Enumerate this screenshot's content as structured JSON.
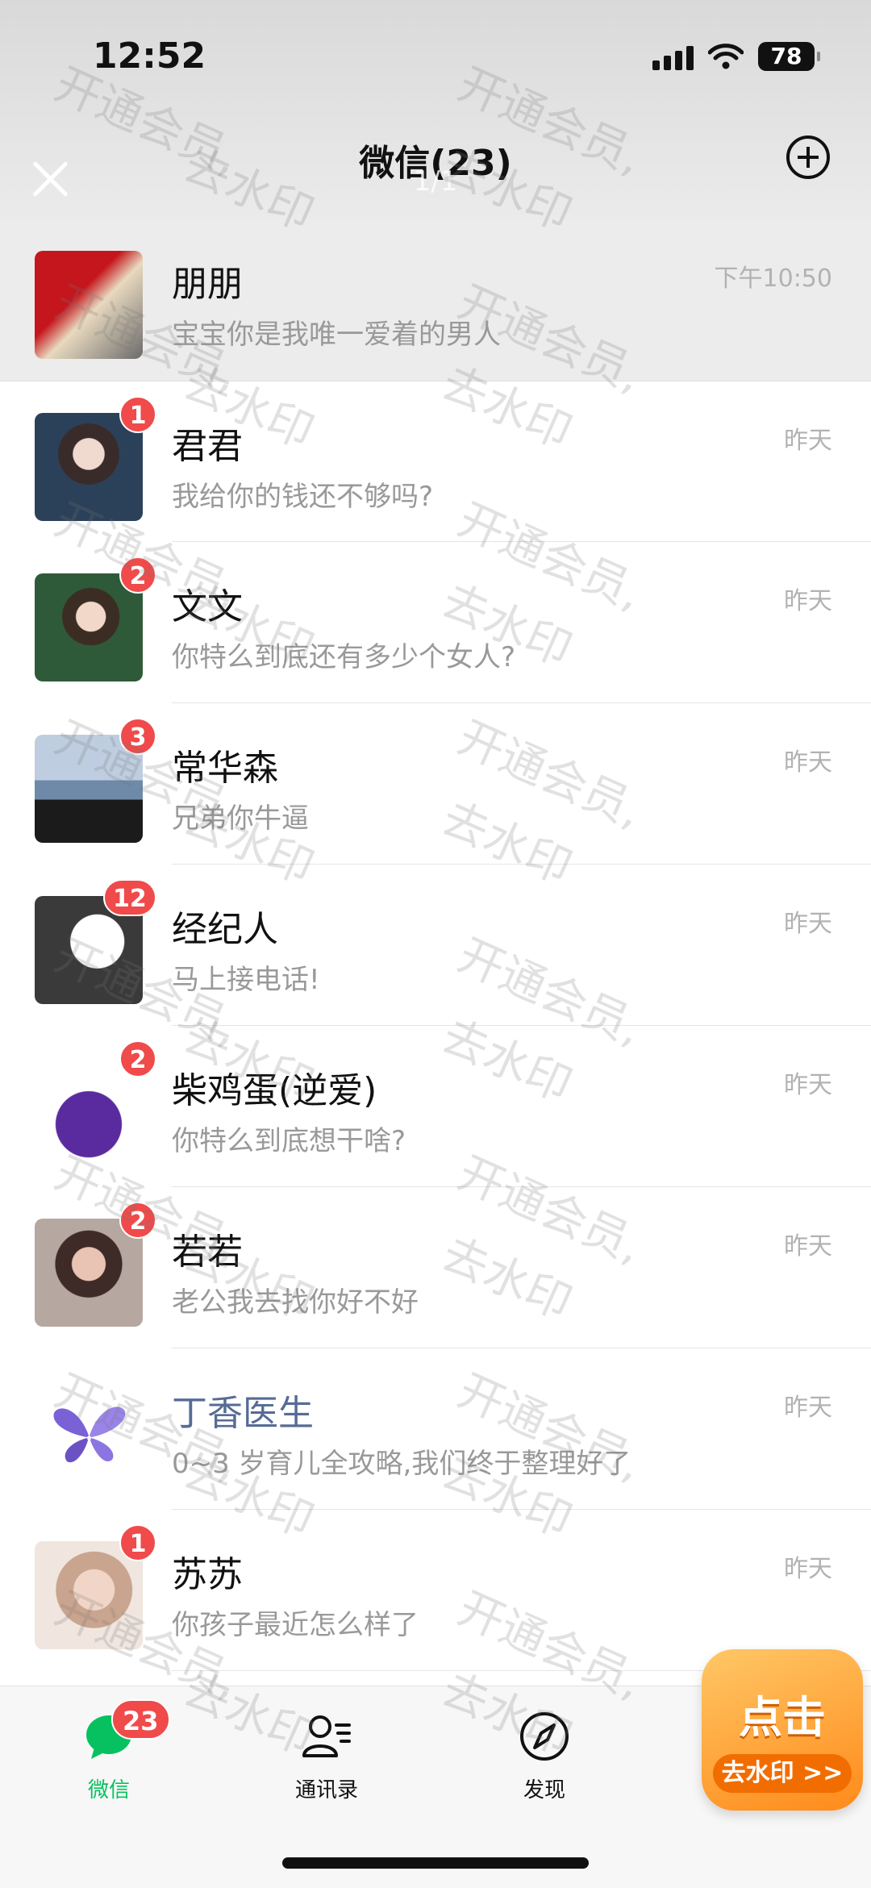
{
  "status_bar": {
    "time": "12:52",
    "battery": "78"
  },
  "nav": {
    "title": "微信(23)",
    "page_indicator": "1/1"
  },
  "chats": [
    {
      "name": "朋朋",
      "preview": "宝宝你是我唯一爱着的男人",
      "time": "下午10:50",
      "badge": "",
      "pinned": true
    },
    {
      "name": "君君",
      "preview": "我给你的钱还不够吗?",
      "time": "昨天",
      "badge": "1"
    },
    {
      "name": "文文",
      "preview": "你特么到底还有多少个女人?",
      "time": "昨天",
      "badge": "2"
    },
    {
      "name": "常华森",
      "preview": "兄弟你牛逼",
      "time": "昨天",
      "badge": "3"
    },
    {
      "name": "经纪人",
      "preview": "马上接电话!",
      "time": "昨天",
      "badge": "12"
    },
    {
      "name": "柴鸡蛋(逆爱)",
      "preview": "你特么到底想干啥?",
      "time": "昨天",
      "badge": "2"
    },
    {
      "name": "若若",
      "preview": "老公我去找你好不好",
      "time": "昨天",
      "badge": "2"
    },
    {
      "name": "丁香医生",
      "preview": "0~3 岁育儿全攻略,我们终于整理好了",
      "time": "昨天",
      "badge": ""
    },
    {
      "name": "苏苏",
      "preview": "你孩子最近怎么样了",
      "time": "昨天",
      "badge": "1"
    }
  ],
  "tabbar": {
    "tabs": [
      {
        "label": "微信",
        "icon": "chat-bubble-icon",
        "badge": "23",
        "active": true
      },
      {
        "label": "通讯录",
        "icon": "contacts-icon"
      },
      {
        "label": "发现",
        "icon": "compass-icon"
      }
    ]
  },
  "promo": {
    "main": "点击",
    "sub": "去水印 >>"
  },
  "watermark": {
    "text_1": "开通会员,",
    "text_2": "去水印"
  },
  "colors": {
    "accent": "#07c160",
    "badge": "#f04a4a",
    "official_name": "#576b95"
  }
}
